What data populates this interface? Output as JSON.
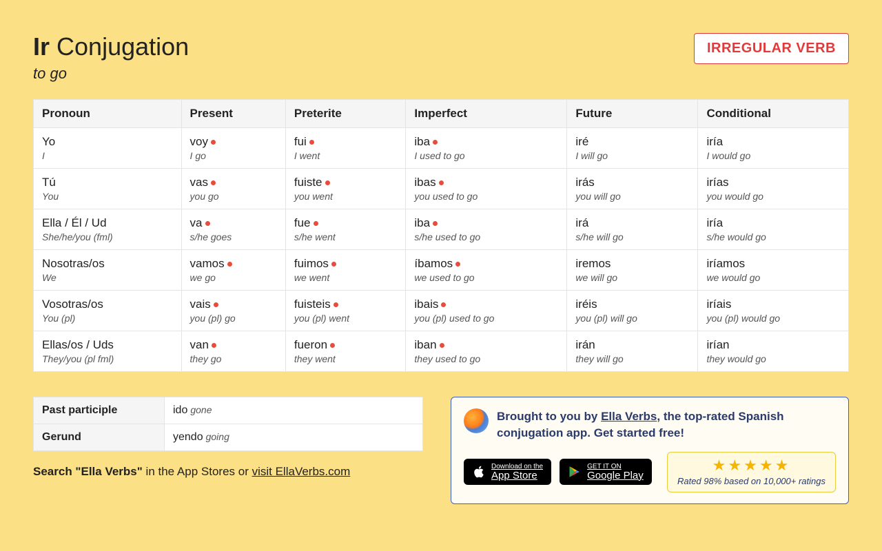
{
  "header": {
    "verb": "Ir",
    "title_suffix": "Conjugation",
    "subtitle": "to go",
    "badge": "IRREGULAR VERB"
  },
  "columns": [
    "Pronoun",
    "Present",
    "Preterite",
    "Imperfect",
    "Future",
    "Conditional"
  ],
  "pronouns": [
    {
      "main": "Yo",
      "gloss": "I"
    },
    {
      "main": "Tú",
      "gloss": "You"
    },
    {
      "main": "Ella / Él / Ud",
      "gloss": "She/he/you (fml)"
    },
    {
      "main": "Nosotras/os",
      "gloss": "We"
    },
    {
      "main": "Vosotras/os",
      "gloss": "You (pl)"
    },
    {
      "main": "Ellas/os / Uds",
      "gloss": "They/you (pl fml)"
    }
  ],
  "tenses": {
    "present": [
      {
        "form": "voy",
        "gloss": "I go",
        "irregular": true
      },
      {
        "form": "vas",
        "gloss": "you go",
        "irregular": true
      },
      {
        "form": "va",
        "gloss": "s/he goes",
        "irregular": true
      },
      {
        "form": "vamos",
        "gloss": "we go",
        "irregular": true
      },
      {
        "form": "vais",
        "gloss": "you (pl) go",
        "irregular": true
      },
      {
        "form": "van",
        "gloss": "they go",
        "irregular": true
      }
    ],
    "preterite": [
      {
        "form": "fui",
        "gloss": "I went",
        "irregular": true
      },
      {
        "form": "fuiste",
        "gloss": "you went",
        "irregular": true
      },
      {
        "form": "fue",
        "gloss": "s/he went",
        "irregular": true
      },
      {
        "form": "fuimos",
        "gloss": "we went",
        "irregular": true
      },
      {
        "form": "fuisteis",
        "gloss": "you (pl) went",
        "irregular": true
      },
      {
        "form": "fueron",
        "gloss": "they went",
        "irregular": true
      }
    ],
    "imperfect": [
      {
        "form": "iba",
        "gloss": "I used to go",
        "irregular": true
      },
      {
        "form": "ibas",
        "gloss": "you used to go",
        "irregular": true
      },
      {
        "form": "iba",
        "gloss": "s/he used to go",
        "irregular": true
      },
      {
        "form": "íbamos",
        "gloss": "we used to go",
        "irregular": true
      },
      {
        "form": "ibais",
        "gloss": "you (pl) used to go",
        "irregular": true
      },
      {
        "form": "iban",
        "gloss": "they used to go",
        "irregular": true
      }
    ],
    "future": [
      {
        "form": "iré",
        "gloss": "I will go",
        "irregular": false
      },
      {
        "form": "irás",
        "gloss": "you will go",
        "irregular": false
      },
      {
        "form": "irá",
        "gloss": "s/he will go",
        "irregular": false
      },
      {
        "form": "iremos",
        "gloss": "we will go",
        "irregular": false
      },
      {
        "form": "iréis",
        "gloss": "you (pl) will go",
        "irregular": false
      },
      {
        "form": "irán",
        "gloss": "they will go",
        "irregular": false
      }
    ],
    "conditional": [
      {
        "form": "iría",
        "gloss": "I would go",
        "irregular": false
      },
      {
        "form": "irías",
        "gloss": "you would go",
        "irregular": false
      },
      {
        "form": "iría",
        "gloss": "s/he would go",
        "irregular": false
      },
      {
        "form": "iríamos",
        "gloss": "we would go",
        "irregular": false
      },
      {
        "form": "iríais",
        "gloss": "you (pl) would go",
        "irregular": false
      },
      {
        "form": "irían",
        "gloss": "they would go",
        "irregular": false
      }
    ]
  },
  "participles": {
    "past_label": "Past participle",
    "past_form": "ido",
    "past_gloss": "gone",
    "gerund_label": "Gerund",
    "gerund_form": "yendo",
    "gerund_gloss": "going"
  },
  "search_line": {
    "prefix": "Search \"Ella Verbs\"",
    "middle": " in the App Stores or ",
    "link": "visit EllaVerbs.com"
  },
  "promo": {
    "text_prefix": "Brought to you by ",
    "link": "Ella Verbs",
    "text_suffix": ", the top-rated Spanish conjugation app. Get started free!",
    "appstore_small": "Download on the",
    "appstore_big": "App Store",
    "play_small": "GET IT ON",
    "play_big": "Google Play",
    "rating_text": "Rated 98% based on 10,000+ ratings"
  }
}
